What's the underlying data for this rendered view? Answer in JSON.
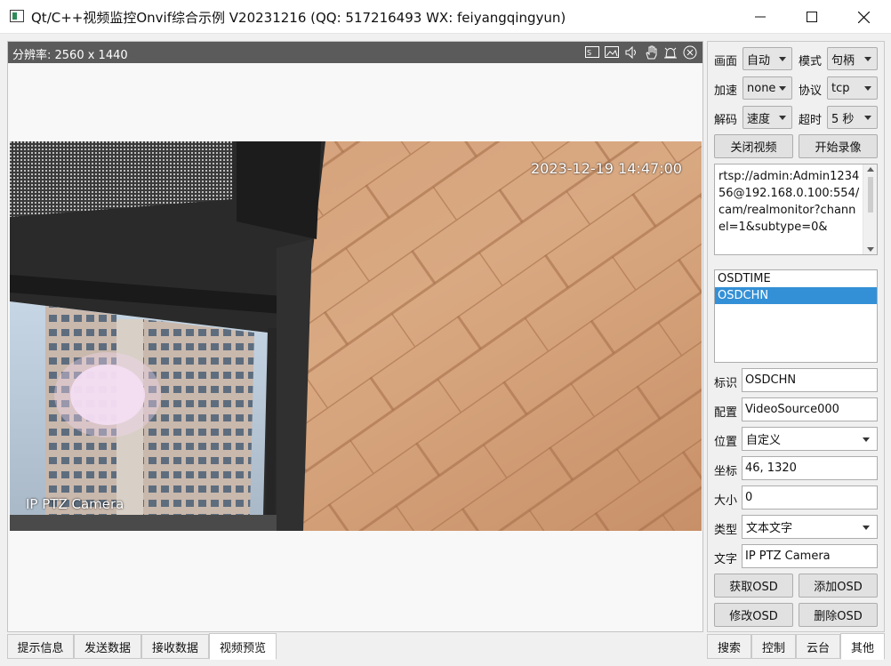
{
  "window": {
    "title": "Qt/C++视频监控Onvif综合示例 V20231216 (QQ: 517216493 WX: feiyangqingyun)"
  },
  "video": {
    "resolution_label": "分辨率: 2560 x 1440",
    "osd_time": "2023-12-19 14:47:00",
    "osd_channel": "IP PTZ Camera",
    "header_icons": [
      "snapshot-icon",
      "image-icon",
      "speaker-icon",
      "hand-icon",
      "alarm-icon",
      "close-circle-icon"
    ]
  },
  "bottom_tabs": [
    "提示信息",
    "发送数据",
    "接收数据",
    "视频预览"
  ],
  "right_tabs": [
    "搜索",
    "控制",
    "云台",
    "其他"
  ],
  "settings": {
    "picture_label": "画面",
    "picture_value": "自动",
    "mode_label": "模式",
    "mode_value": "句柄",
    "accel_label": "加速",
    "accel_value": "none",
    "protocol_label": "协议",
    "protocol_value": "tcp",
    "decode_label": "解码",
    "decode_value": "速度",
    "timeout_label": "超时",
    "timeout_value": "5 秒"
  },
  "actions": {
    "close_video": "关闭视频",
    "start_record": "开始录像"
  },
  "url": "rtsp://admin:Admin123456@192.168.0.100:554/cam/realmonitor?channel=1&subtype=0&",
  "osd_list": [
    "OSDTIME",
    "OSDCHN"
  ],
  "osd_form": {
    "id_label": "标识",
    "id_value": "OSDCHN",
    "config_label": "配置",
    "config_value": "VideoSource000",
    "position_label": "位置",
    "position_value": "自定义",
    "coord_label": "坐标",
    "coord_value": "46, 1320",
    "size_label": "大小",
    "size_value": "0",
    "type_label": "类型",
    "type_value": "文本文字",
    "text_label": "文字",
    "text_value": "IP PTZ Camera"
  },
  "osd_buttons": {
    "get": "获取OSD",
    "add": "添加OSD",
    "modify": "修改OSD",
    "delete": "删除OSD"
  }
}
